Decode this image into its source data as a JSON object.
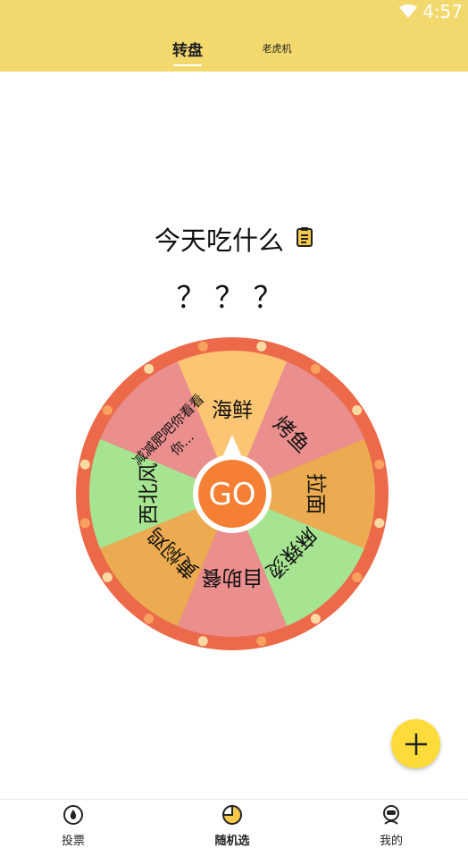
{
  "status_bar": {
    "time": "4:57"
  },
  "tabs": [
    {
      "label": "转盘",
      "active": true
    },
    {
      "label": "老虎机",
      "active": false
    }
  ],
  "question": "今天吃什么",
  "answer": "？？？",
  "wheel": {
    "center_label": "GO",
    "segments": [
      {
        "label": "海鲜",
        "color": "#fcc574"
      },
      {
        "label": "烤鱼",
        "color": "#ea8e8e"
      },
      {
        "label": "拉面",
        "color": "#ecab50"
      },
      {
        "label": "麻辣烫",
        "color": "#a6e491"
      },
      {
        "label": "自助餐",
        "color": "#ea8e8e"
      },
      {
        "label": "黄焖鸡",
        "color": "#ecab50"
      },
      {
        "label": "西北风",
        "color": "#a6e491"
      },
      {
        "label": "减减肥吧你看看你...",
        "color": "#ea8e8e"
      }
    ],
    "rim_color": "#ec6a4a"
  },
  "bottom_nav": [
    {
      "label": "投票",
      "icon": "vote-drop-icon",
      "active": false
    },
    {
      "label": "随机选",
      "icon": "pie-chart-icon",
      "active": true
    },
    {
      "label": "我的",
      "icon": "robot-face-icon",
      "active": false
    }
  ],
  "colors": {
    "header": "#f3d86d",
    "fab": "#fddb3a",
    "go_button": "#f57f32"
  }
}
